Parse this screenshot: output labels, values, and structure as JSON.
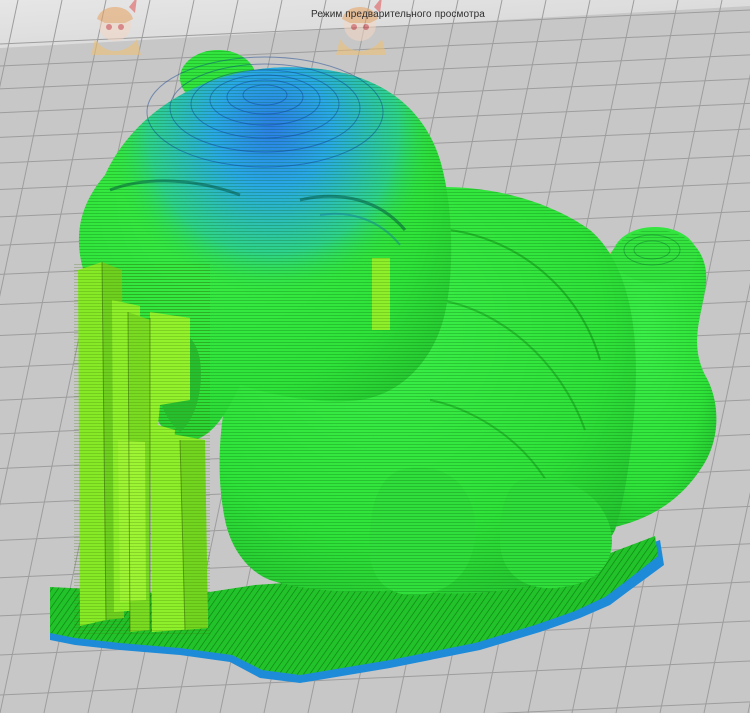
{
  "viewport": {
    "mode_label": "Режим предварительного просмотра",
    "background_color": "#c7c7c7",
    "grid_line_color": "#9d9d9d",
    "background_corner_color": "#dedede",
    "model_color": "#2ee63a",
    "model_top_color": "#2e9ee8",
    "support_color": "#8ef02a",
    "base_raft_colors": [
      "#22c32a",
      "#1e8bd9"
    ],
    "watermark_icon": "anime-girl-watermark-icon"
  }
}
